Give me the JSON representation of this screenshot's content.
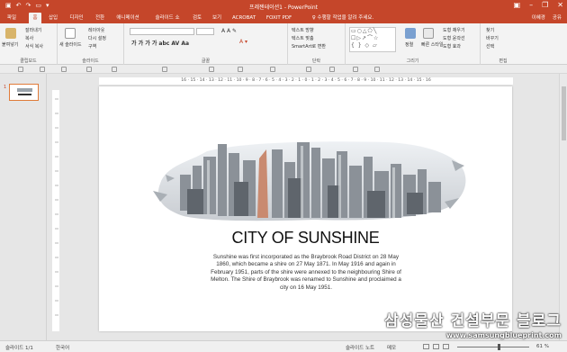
{
  "titlebar": {
    "title": "프레젠테이션1 - PowerPoint",
    "restore_icon": "restore-icon"
  },
  "tabs": [
    "파일",
    "홈",
    "삽입",
    "디자인",
    "전환",
    "애니메이션",
    "슬라이드 쇼",
    "검토",
    "보기",
    "ACROBAT",
    "FOXIT PDF",
    "♀ 수행할 작업을 알려 주세요."
  ],
  "active_tab": "홈",
  "user": {
    "name": "이혜경",
    "share": "공유"
  },
  "ribbon": {
    "clipboard": {
      "paste": "붙여넣기",
      "cut": "잘라내기",
      "copy": "복사",
      "format_painter": "서식 복사",
      "label": "클립보드"
    },
    "slides": {
      "new_slide": "새 슬라이드",
      "layout": "레이아웃",
      "reset": "다시 설정",
      "section": "구역",
      "label": "슬라이드"
    },
    "font": {
      "label": "글꼴"
    },
    "paragraph": {
      "text_direction": "텍스트 방향",
      "align_text": "텍스트 맞춤",
      "smartart": "SmartArt로 변환",
      "label": "단락"
    },
    "drawing": {
      "arrange": "정렬",
      "quick_styles": "빠른 스타일",
      "shape_fill": "도형 채우기",
      "shape_outline": "도형 윤곽선",
      "shape_effects": "도형 효과",
      "label": "그리기"
    },
    "editing": {
      "find": "찾기",
      "replace": "바꾸기",
      "select": "선택",
      "label": "편집"
    }
  },
  "ruler_text": "16 · 15 · 14 · 13 · 12 · 11 · 10 · 9 · 8 · 7 · 6 · 5 · 4 · 3 · 2 · 1 · 0 · 1 · 2 · 3 · 4 · 5 · 6 · 7 · 8 · 9 · 10 · 11 · 12 · 13 · 14 · 15 · 16",
  "thumb_number": "1",
  "slide": {
    "title": "CITY OF SUNSHINE",
    "body": "Sunshine was first incorporated as the Braybrook Road District on 28 May 1860, which became a shire on 27 May 1871. In May 1916 and again in February 1951, parts of the shire were annexed to the neighbouring Shire of Melton. The Shire of Braybrook was renamed to Sunshine and proclaimed a city on 16 May 1951."
  },
  "status": {
    "slide": "슬라이드 1/1",
    "language": "한국어",
    "notes": "슬라이드 노트",
    "comments": "메모",
    "zoom": "61 %",
    "zoom_fraction": 0.55
  },
  "watermark": {
    "line1": "삼성물산 건설부문 블로그",
    "line2": "www.samsungblueprint.com"
  },
  "colors": {
    "accent": "#c5462a"
  }
}
